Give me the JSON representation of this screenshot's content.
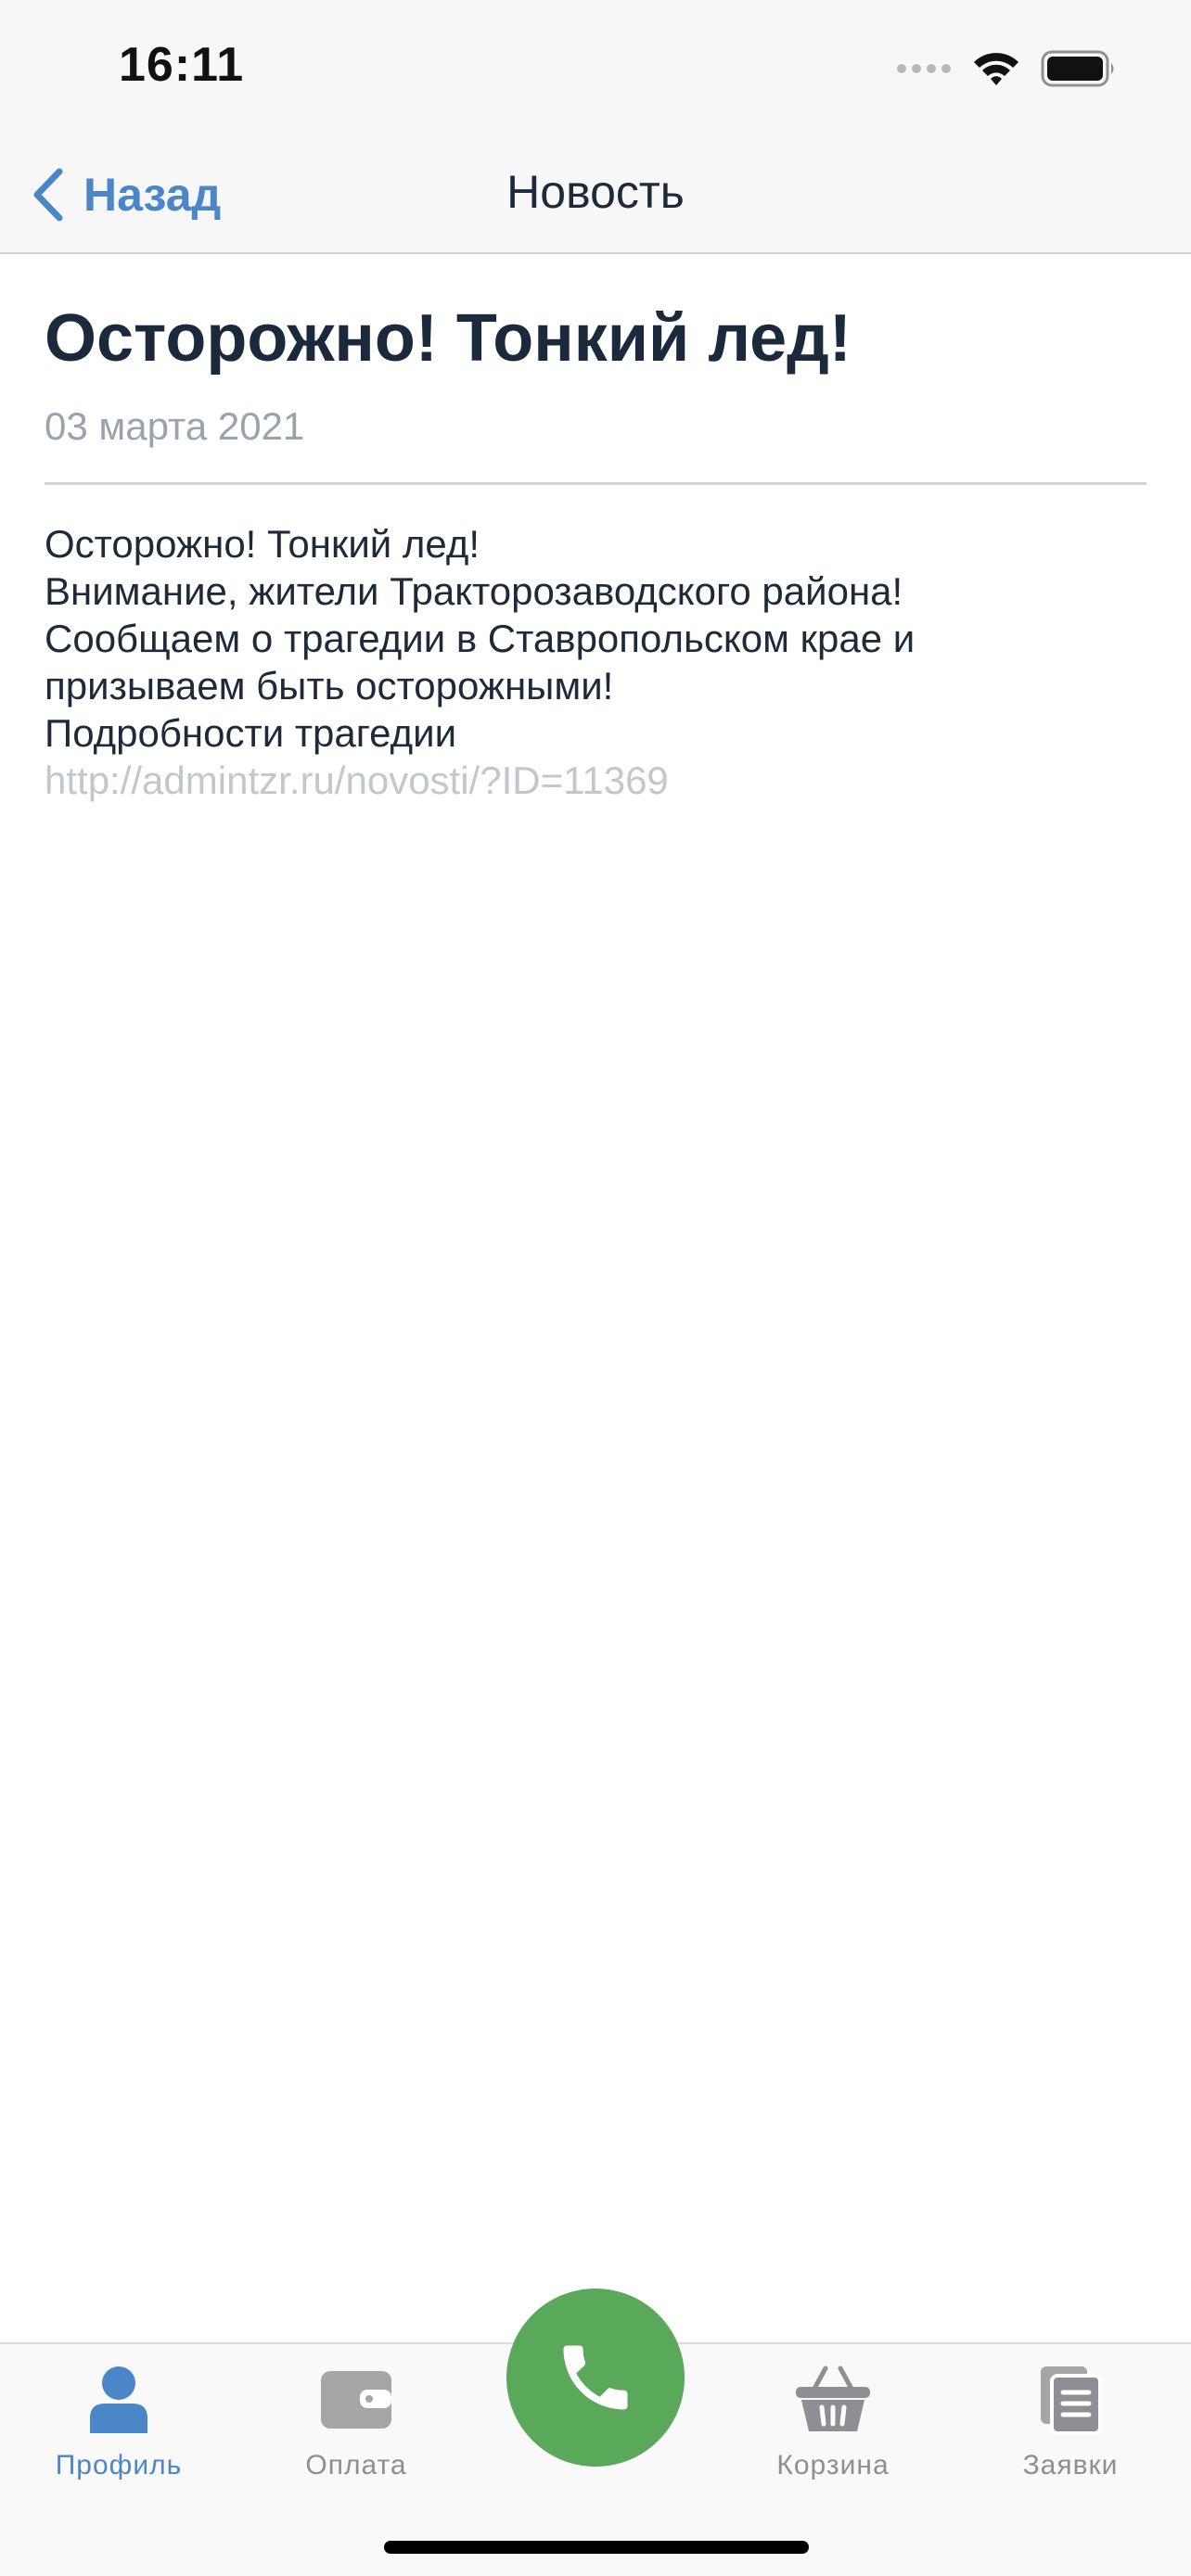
{
  "status_bar": {
    "time": "16:11"
  },
  "nav": {
    "back_label": "Назад",
    "title": "Новость"
  },
  "article": {
    "title": "Осторожно! Тонкий лед!",
    "date": "03 марта 2021",
    "body_lines": [
      "Осторожно! Тонкий лед!",
      "Внимание, жители Тракторозаводского района!",
      "Сообщаем о трагедии в Ставропольском крае и",
      "призываем быть осторожными!",
      "Подробности трагедии"
    ],
    "link": "http://admintzr.ru/novosti/?ID=11369"
  },
  "tabs": [
    {
      "label": "Профиль",
      "icon": "profile-icon",
      "active": true
    },
    {
      "label": "Оплата",
      "icon": "wallet-icon",
      "active": false
    },
    {
      "label": "Корзина",
      "icon": "basket-icon",
      "active": false
    },
    {
      "label": "Заявки",
      "icon": "documents-icon",
      "active": false
    }
  ],
  "colors": {
    "accent": "#4a86c8",
    "call_button": "#5aa85a",
    "inactive": "#8e8e93",
    "link": "#c2c7cc",
    "date": "#9aa3ad"
  }
}
